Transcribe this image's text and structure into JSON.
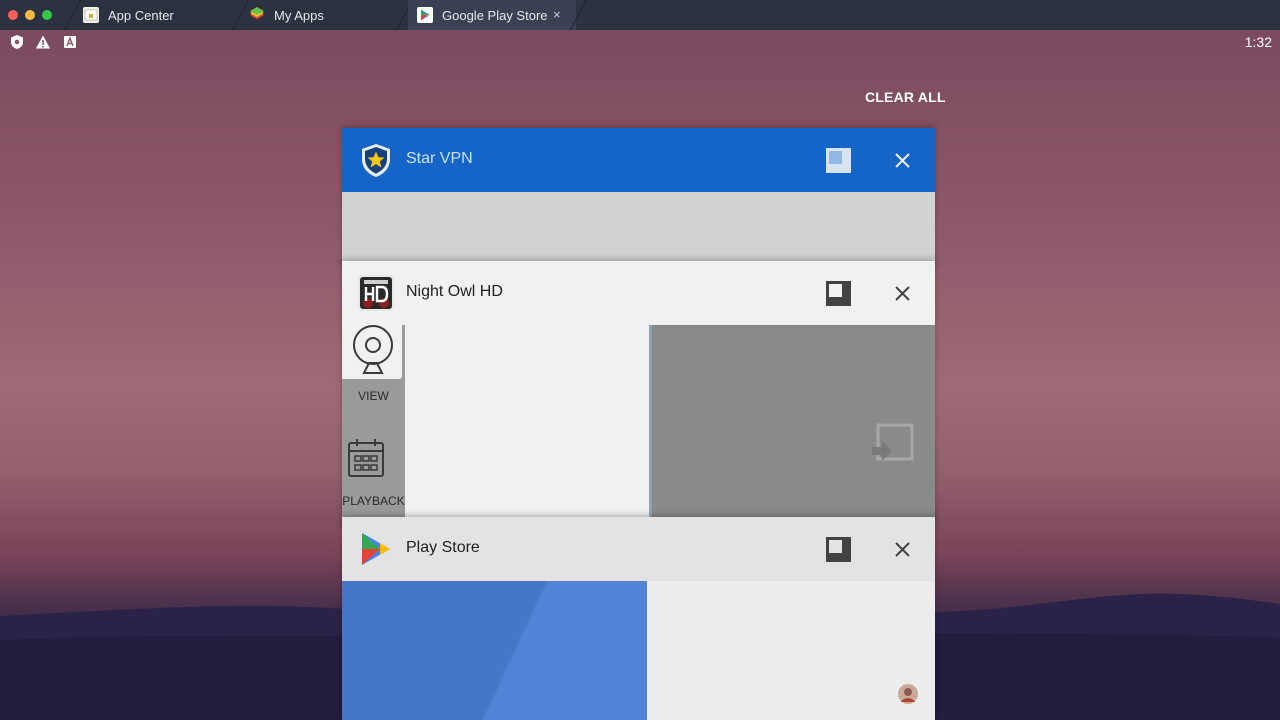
{
  "browser_tabs": [
    {
      "label": "App Center",
      "icon": "app-center-icon"
    },
    {
      "label": "My Apps",
      "icon": "my-apps-icon"
    },
    {
      "label": "Google Play Store",
      "icon": "play-store-icon",
      "active": true
    }
  ],
  "tab_close_glyph": "×",
  "status": {
    "time": "1:32"
  },
  "recents": {
    "clear_all": "CLEAR ALL",
    "cards": [
      {
        "title": "Star VPN",
        "header_color": "#1565c8",
        "title_color": "#cfe1f7"
      },
      {
        "title": "Night Owl HD",
        "header_color": "#f1f1f1",
        "title_color": "#212121",
        "preview": {
          "view_label": "VIEW",
          "playback_label": "PLAYBACK"
        }
      },
      {
        "title": "Play Store",
        "header_color": "#e3e3e3",
        "title_color": "#212121"
      }
    ]
  },
  "colors": {
    "accent_blue": "#1565c8",
    "play_blue": "#4a7bd2"
  }
}
